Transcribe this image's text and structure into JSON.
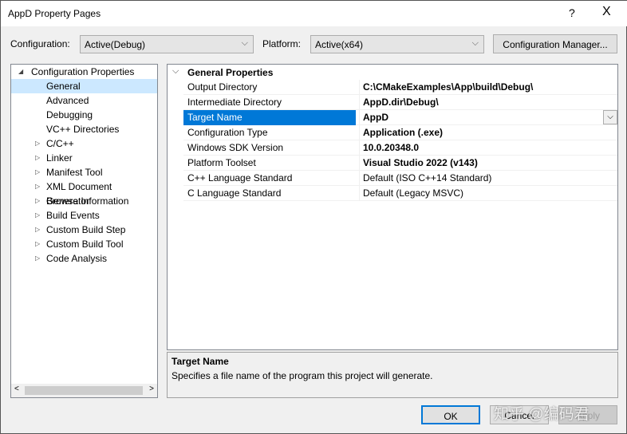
{
  "window": {
    "title": "AppD Property Pages",
    "help": "?",
    "close": "X"
  },
  "toolbar": {
    "config_label": "Configuration:",
    "config_value": "Active(Debug)",
    "platform_label": "Platform:",
    "platform_value": "Active(x64)",
    "config_manager": "Configuration Manager..."
  },
  "tree": {
    "root": "Configuration Properties",
    "items": [
      {
        "label": "General",
        "expandable": false,
        "selected": true
      },
      {
        "label": "Advanced",
        "expandable": false
      },
      {
        "label": "Debugging",
        "expandable": false
      },
      {
        "label": "VC++ Directories",
        "expandable": false
      },
      {
        "label": "C/C++",
        "expandable": true
      },
      {
        "label": "Linker",
        "expandable": true
      },
      {
        "label": "Manifest Tool",
        "expandable": true
      },
      {
        "label": "XML Document Generator",
        "expandable": true
      },
      {
        "label": "Browse Information",
        "expandable": true
      },
      {
        "label": "Build Events",
        "expandable": true
      },
      {
        "label": "Custom Build Step",
        "expandable": true
      },
      {
        "label": "Custom Build Tool",
        "expandable": true
      },
      {
        "label": "Code Analysis",
        "expandable": true
      }
    ]
  },
  "grid": {
    "section": "General Properties",
    "rows": [
      {
        "name": "Output Directory",
        "value": "C:\\CMakeExamples\\App\\build\\Debug\\",
        "bold": true
      },
      {
        "name": "Intermediate Directory",
        "value": "AppD.dir\\Debug\\",
        "bold": true
      },
      {
        "name": "Target Name",
        "value": "AppD",
        "bold": true,
        "selected": true
      },
      {
        "name": "Configuration Type",
        "value": "Application (.exe)",
        "bold": true
      },
      {
        "name": "Windows SDK Version",
        "value": "10.0.20348.0",
        "bold": true
      },
      {
        "name": "Platform Toolset",
        "value": "Visual Studio 2022 (v143)",
        "bold": true
      },
      {
        "name": "C++ Language Standard",
        "value": "Default (ISO C++14 Standard)",
        "bold": false
      },
      {
        "name": "C Language Standard",
        "value": "Default (Legacy MSVC)",
        "bold": false
      }
    ]
  },
  "description": {
    "title": "Target Name",
    "text": "Specifies a file name of the program this project will generate."
  },
  "buttons": {
    "ok": "OK",
    "cancel": "Cancel",
    "apply": "Apply"
  },
  "watermark": "知乎 @编码君"
}
